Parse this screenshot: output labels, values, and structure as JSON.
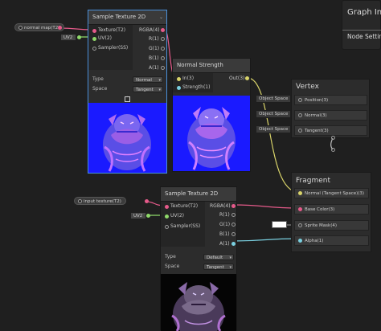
{
  "graph_inspector": {
    "title": "Graph Ins",
    "tab": "Node Settir"
  },
  "property_normal_map": "normal map(T2)",
  "property_input_texture": "input texture(T2)",
  "uv_field_top": "UV2",
  "uv_field_bottom": "UV2",
  "sample_texture_top": {
    "title": "Sample Texture 2D",
    "inputs": [
      "Texture(T2)",
      "UV(2)",
      "Sampler(SS)"
    ],
    "outputs": [
      "RGBA(4)",
      "R(1)",
      "G(1)",
      "B(1)",
      "A(1)"
    ],
    "type_label": "Type",
    "type_value": "Normal",
    "space_label": "Space",
    "space_value": "Tangent"
  },
  "normal_strength": {
    "title": "Normal Strength",
    "inputs": [
      "In(3)",
      "Strength(1)"
    ],
    "outputs": [
      "Out(3)"
    ]
  },
  "vertex": {
    "title": "Vertex",
    "slots": [
      "Position(3)",
      "Normal(3)",
      "Tangent(3)"
    ],
    "contexts": [
      "Object Space",
      "Object Space",
      "Object Space"
    ]
  },
  "fragment": {
    "title": "Fragment",
    "slots": [
      "Normal (Tangent Space)(3)",
      "Base Color(3)",
      "Sprite Mask(4)",
      "Alpha(1)"
    ]
  },
  "sample_texture_bottom": {
    "title": "Sample Texture 2D",
    "inputs": [
      "Texture(T2)",
      "UV(2)",
      "Sampler(SS)"
    ],
    "outputs": [
      "RGBA(4)",
      "R(1)",
      "G(1)",
      "B(1)",
      "A(1)"
    ],
    "type_label": "Type",
    "type_value": "Default",
    "space_label": "Space",
    "space_value": "Tangent"
  },
  "colors": {
    "background": "#1f1f1f",
    "node": "#2c2c2c",
    "selected_border": "#4a8fd9",
    "texture_port": "#e55a8a",
    "vector2_port": "#8fd96a",
    "vector3_port": "#d9d46a",
    "float_port": "#7ad0e0",
    "normal_map_blue": "#1a1aff"
  }
}
